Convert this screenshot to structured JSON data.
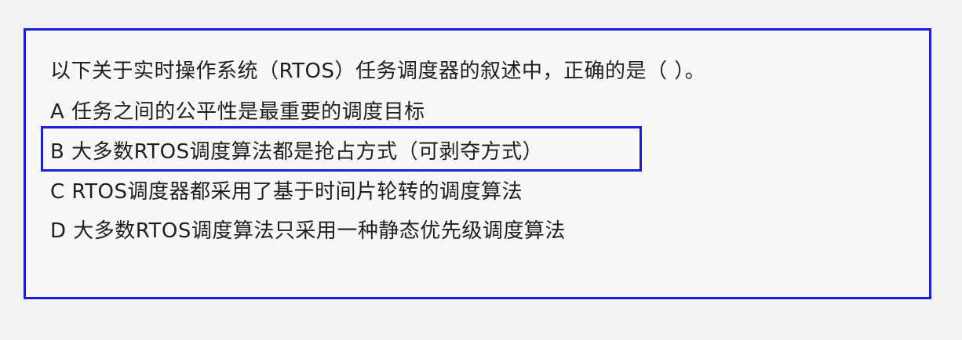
{
  "question": {
    "stem": "以下关于实时操作系统（RTOS）任务调度器的叙述中，正确的是（ ）。",
    "options": [
      {
        "letter": "A",
        "text": "任务之间的公平性是最重要的调度目标"
      },
      {
        "letter": "B",
        "text": "大多数RTOS调度算法都是抢占方式（可剥夺方式）"
      },
      {
        "letter": "C",
        "text": "RTOS调度器都采用了基于时间片轮转的调度算法"
      },
      {
        "letter": "D",
        "text": "大多数RTOS调度算法只采用一种静态优先级调度算法"
      }
    ],
    "highlighted_option": "B"
  },
  "colors": {
    "border": "#1c1cd9",
    "text": "#1f1f1f",
    "background": "#f2f2f2"
  }
}
